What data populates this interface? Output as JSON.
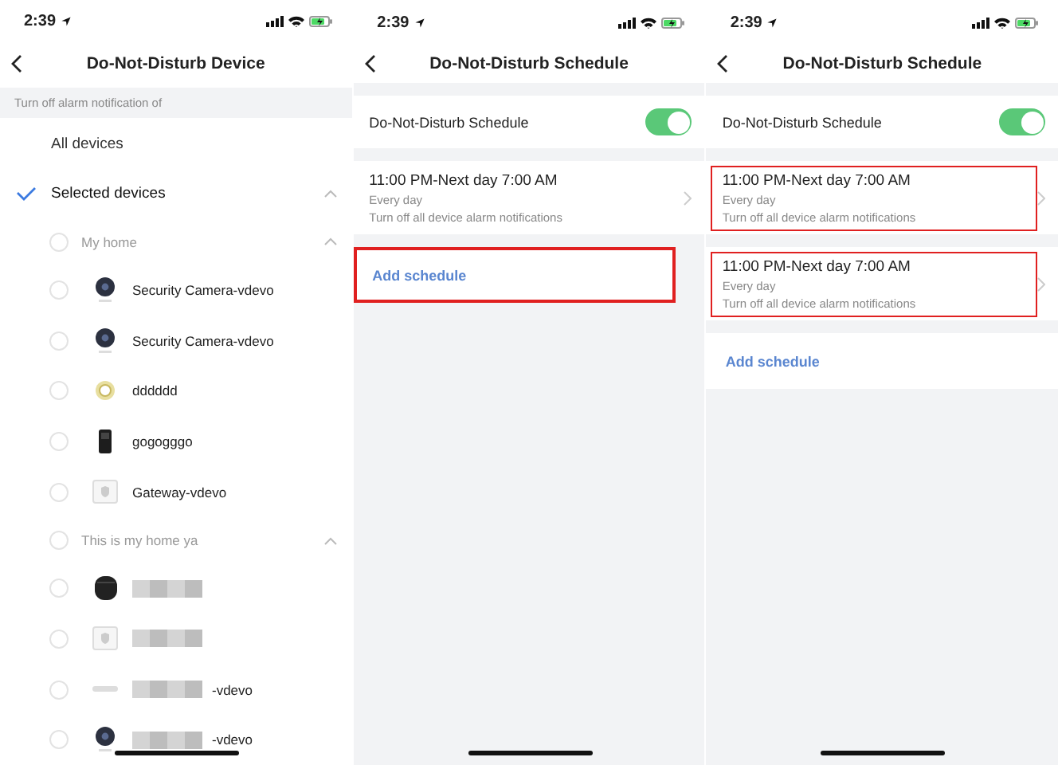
{
  "screens": [
    {
      "kind": "device_list",
      "status_bar": {
        "time": "2:39"
      },
      "title": "Do-Not-Disturb Device",
      "section_header": "Turn off alarm notification of",
      "options": [
        {
          "label": "All devices",
          "selected": false
        },
        {
          "label": "Selected devices",
          "selected": true,
          "expanded": true
        }
      ],
      "homes": [
        {
          "name": "My home",
          "checked": false,
          "expanded": true,
          "devices": [
            {
              "kind": "camera",
              "name": "Security Camera-vdevo",
              "checked": false
            },
            {
              "kind": "camera",
              "name": "Security Camera-vdevo",
              "checked": false
            },
            {
              "kind": "sensor",
              "name": "dddddd",
              "checked": false
            },
            {
              "kind": "doorbell",
              "name": "gogogggo",
              "checked": false
            },
            {
              "kind": "gateway",
              "name": "Gateway-vdevo",
              "checked": false
            }
          ]
        },
        {
          "name": "This is my home ya",
          "checked": false,
          "expanded": true,
          "devices": [
            {
              "kind": "speaker",
              "checked": false,
              "redacted": true
            },
            {
              "kind": "gateway",
              "checked": false,
              "redacted": true
            },
            {
              "kind": "hub",
              "name": "-vdevo",
              "checked": false,
              "redacted": true
            },
            {
              "kind": "camera",
              "name": "-vdevo",
              "checked": false,
              "redacted": true
            }
          ]
        }
      ]
    },
    {
      "kind": "schedule",
      "status_bar": {
        "time": "2:39"
      },
      "title": "Do-Not-Disturb Schedule",
      "toggle": {
        "label": "Do-Not-Disturb Schedule",
        "on": true
      },
      "schedules": [
        {
          "time": "11:00 PM-Next day 7:00 AM",
          "repeat": "Every day",
          "description": "Turn off all device alarm notifications",
          "highlighted": false
        }
      ],
      "add_button": {
        "label": "Add schedule",
        "highlighted": true
      }
    },
    {
      "kind": "schedule",
      "status_bar": {
        "time": "2:39"
      },
      "title": "Do-Not-Disturb Schedule",
      "toggle": {
        "label": "Do-Not-Disturb Schedule",
        "on": true
      },
      "schedules": [
        {
          "time": "11:00 PM-Next day 7:00 AM",
          "repeat": "Every day",
          "description": "Turn off all device alarm notifications",
          "highlighted": true
        },
        {
          "time": "11:00 PM-Next day 7:00 AM",
          "repeat": "Every day",
          "description": "Turn off all device alarm notifications",
          "highlighted": true
        }
      ],
      "add_button": {
        "label": "Add schedule",
        "highlighted": false
      }
    }
  ]
}
